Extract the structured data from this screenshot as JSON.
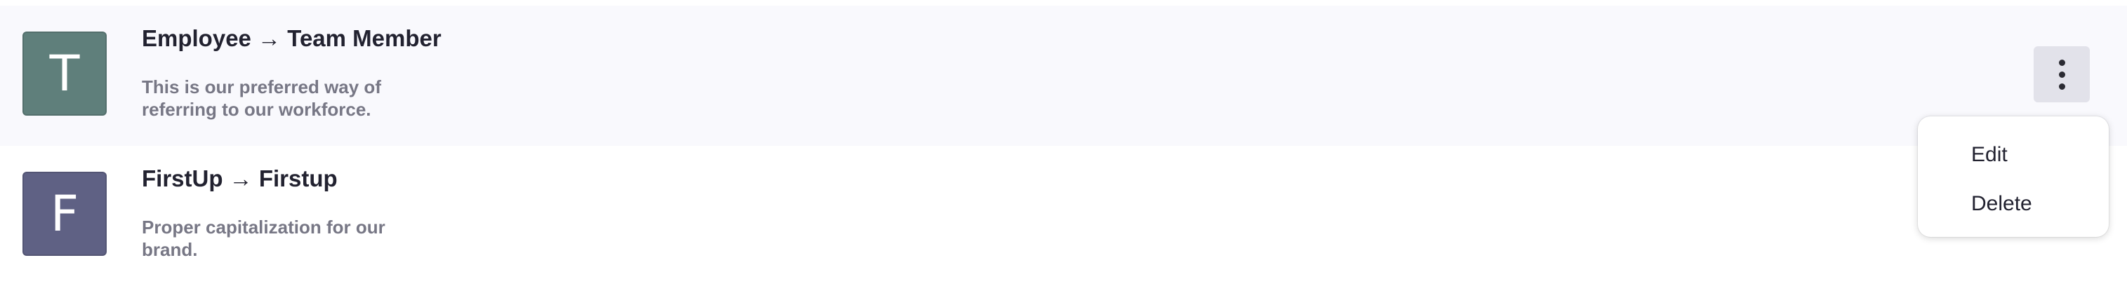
{
  "items": [
    {
      "avatar_letter": "T",
      "avatar_color": "#5f7f7b",
      "title": "Employee → Team Member",
      "description": "This is our preferred way of referring to our workforce."
    },
    {
      "avatar_letter": "F",
      "avatar_color": "#5f6184",
      "title": "FirstUp → Firstup",
      "description": "Proper capitalization for our brand."
    }
  ],
  "menu": {
    "edit_label": "Edit",
    "delete_label": "Delete"
  },
  "colors": {
    "hover_row_background": "#f9f9fd",
    "kebab_background": "#e2e2ea"
  }
}
